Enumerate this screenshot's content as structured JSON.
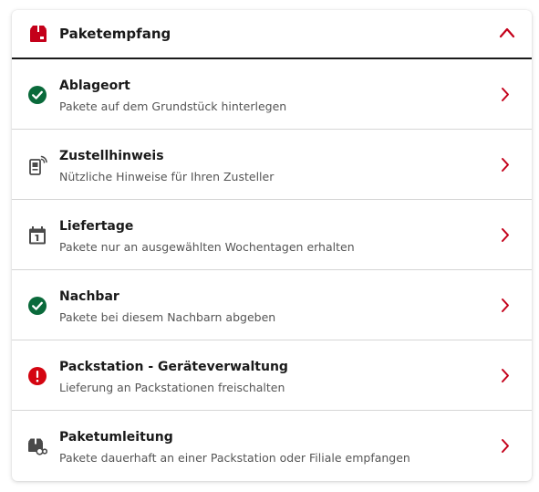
{
  "colors": {
    "accent_red": "#c4001a",
    "success_green": "#0a6a3b",
    "warning_red": "#d40511",
    "icon_gray": "#4a4a4a",
    "text_dark": "#1a1a1a",
    "text_sub": "#555555"
  },
  "section": {
    "title": "Paketempfang",
    "icon": "package-icon",
    "expanded": true,
    "toggle_icon": "chevron-up-icon"
  },
  "items": [
    {
      "title": "Ablageort",
      "subtitle": "Pakete auf dem Grundstück hinterlegen",
      "icon": "check-circle-icon"
    },
    {
      "title": "Zustellhinweis",
      "subtitle": "Nützliche Hinweise für Ihren Zusteller",
      "icon": "phone-note-icon"
    },
    {
      "title": "Liefertage",
      "subtitle": "Pakete nur an ausgewählten Wochentagen erhalten",
      "icon": "calendar-icon"
    },
    {
      "title": "Nachbar",
      "subtitle": "Pakete bei diesem Nachbarn abgeben",
      "icon": "check-circle-icon"
    },
    {
      "title": "Packstation - Geräteverwaltung",
      "subtitle": "Lieferung an Packstationen freischalten",
      "icon": "alert-circle-icon"
    },
    {
      "title": "Paketumleitung",
      "subtitle": "Pakete dauerhaft an einer Packstation oder Filiale empfangen",
      "icon": "package-redirect-icon"
    }
  ]
}
